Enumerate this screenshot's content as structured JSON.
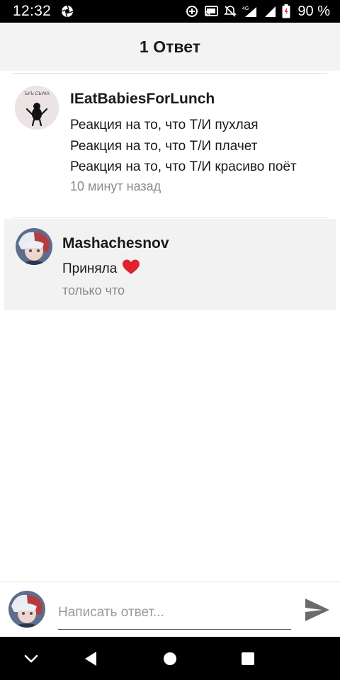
{
  "status_bar": {
    "time": "12:32",
    "battery": "90 %",
    "icons": [
      "aperture-icon",
      "data-saver-icon",
      "cast-icon",
      "notifications-off-icon",
      "signal-4g-icon",
      "signal-icon",
      "battery-icon"
    ]
  },
  "header": {
    "title": "1 Ответ"
  },
  "comment": {
    "author": "IEatBabiesForLunch",
    "avatar_caption": "ЪУЪ СЪУКА",
    "lines": [
      "Реакция на то, что Т/И пухлая",
      "Реакция на то, что Т/И плачет",
      "Реакция на то, что Т/И красиво поёт"
    ],
    "time": "10 минут назад"
  },
  "reply": {
    "author": "Mashachesnov",
    "text": "Приняла",
    "emoji": "❤️",
    "time": "только что"
  },
  "input": {
    "placeholder": "Написать ответ...",
    "value": ""
  },
  "colors": {
    "header_bg": "#f4f3f4",
    "reply_bg": "#f3f2f3",
    "timestamp": "#8a8a8a",
    "heart": "#e0242e",
    "send_icon": "#6b6b6b"
  },
  "nav": {
    "icons": [
      "chevron-down-icon",
      "back-icon",
      "home-icon",
      "recents-icon"
    ]
  }
}
